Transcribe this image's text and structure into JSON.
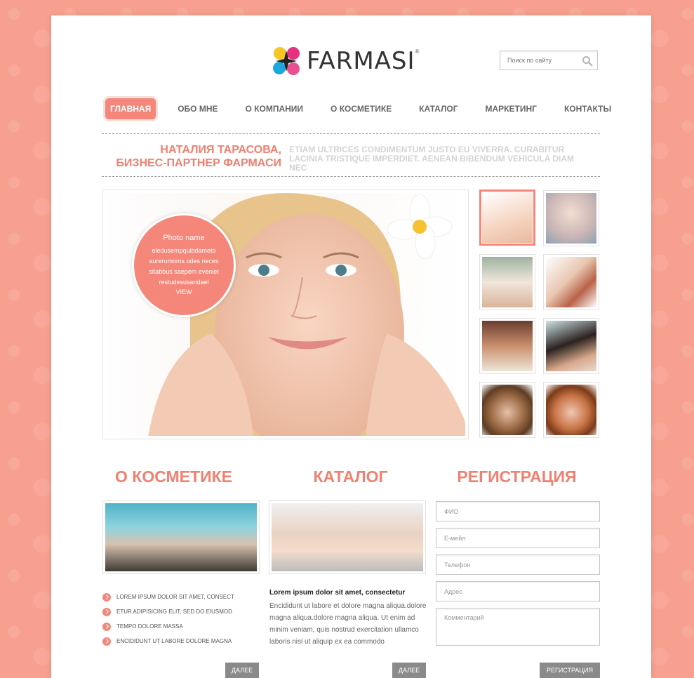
{
  "header": {
    "logo_text": "FARMASI",
    "logo_reg": "®",
    "search_placeholder": "Поиск по сайту"
  },
  "nav": {
    "items": [
      {
        "label": "ГЛАВНАЯ",
        "active": true
      },
      {
        "label": "ОБО МНЕ"
      },
      {
        "label": "О КОМПАНИИ"
      },
      {
        "label": "О КОСМЕТИКЕ"
      },
      {
        "label": "КАТАЛОГ"
      },
      {
        "label": "МАРКЕТИНГ"
      },
      {
        "label": "КОНТАКТЫ"
      }
    ]
  },
  "tagline": {
    "name_line1": "НАТАЛИЯ ТАРАСОВА,",
    "name_line2": "БИЗНЕС-ПАРТНЕР ФАРМАСИ",
    "text": "ETIAM ULTRICES CONDIMENTUM JUSTO EU VIVERRA. CURABITUR LACINIA TRISTIQUE IMPERDIET. AENEAN BIBENDUM VEHICULA DIAM NEC"
  },
  "hero": {
    "photo_name": "Photo name",
    "photo_text": "eledusempquibdameto aurerumoms odes neces sitabbus saepem eveniet restudesusandael",
    "view_label": "VIEW"
  },
  "sections": {
    "cosmetics": {
      "title": "О КОСМЕТИКЕ",
      "bullets": [
        "LOREM IPSUM DOLOR SIT AMET, CONSECT",
        "ETUR ADIPISICING ELIT, SED DO EIUSMOD",
        "TEMPO DOLORE MASSA",
        "ENCIDIDUNT UT LABORE DOLORE MAGNA"
      ],
      "button": "ДАЛЕЕ"
    },
    "catalog": {
      "title": "КАТАЛОГ",
      "heading": "Lorem ipsum dolor sit amet, consectetur",
      "text": "Encididunt ut labore et dolore magna aliqua.dolore magna aliqua.dolore magna aliqua. Ut enim ad minim veniam, quis nostrud exercitation ullamco laboris nisi ut aliquip ex ea commodo",
      "button": "ДАЛЕЕ"
    },
    "registration": {
      "title": "РЕГИСТРАЦИЯ",
      "fields": {
        "name": "ФИО",
        "email": "Е-мейл",
        "phone": "Телефон",
        "address": "Адрес",
        "comment": "Комментарий"
      },
      "button": "РЕГИСТРАЦИЯ"
    }
  },
  "colors": {
    "accent": "#f4877a",
    "heading": "#f08070",
    "background": "#f7a08f",
    "button": "#8a8a8a"
  }
}
